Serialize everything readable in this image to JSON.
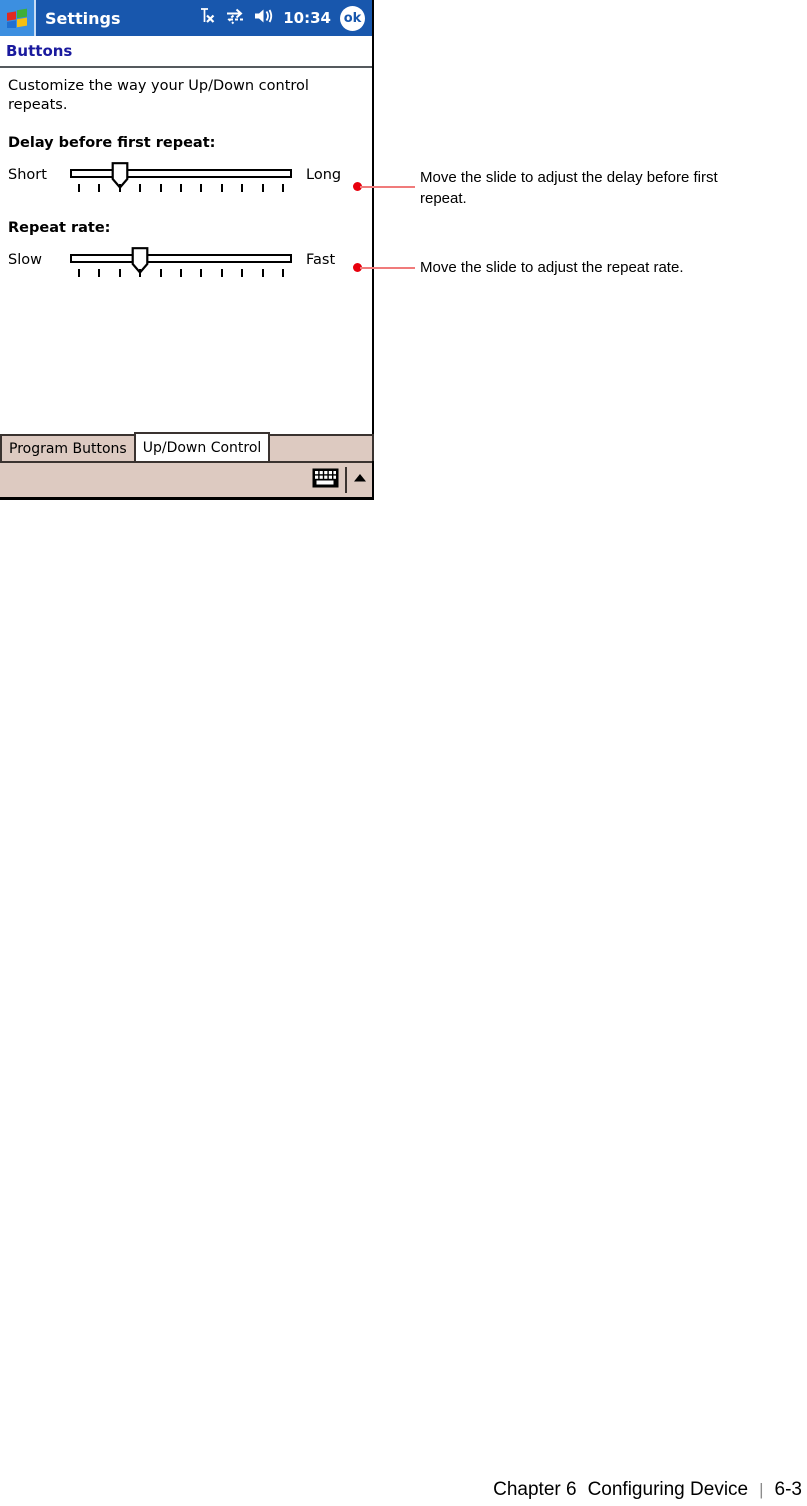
{
  "device": {
    "titlebar": {
      "start_icon": "windows-logo-icon",
      "title": "Settings",
      "icons": [
        {
          "name": "signal-no-service-icon",
          "glyph": "Tx"
        },
        {
          "name": "connectivity-icon",
          "glyph": "arrows"
        },
        {
          "name": "volume-speaker-icon",
          "glyph": "speaker"
        }
      ],
      "time": "10:34",
      "ok_label": "ok"
    },
    "page_title": "Buttons",
    "description": "Customize the way your Up/Down control repeats.",
    "settings": [
      {
        "id": "delay-before-first-repeat",
        "label": "Delay before first repeat:",
        "min_label": "Short",
        "max_label": "Long",
        "ticks": 11,
        "value_index": 2
      },
      {
        "id": "repeat-rate",
        "label": "Repeat rate:",
        "min_label": "Slow",
        "max_label": "Fast",
        "ticks": 11,
        "value_index": 3
      }
    ],
    "tabs": [
      {
        "label": "Program Buttons",
        "active": false
      },
      {
        "label": "Up/Down Control",
        "active": true
      },
      {
        "label": "",
        "active": false
      }
    ],
    "taskbar": {
      "keyboard_icon": "keyboard-icon",
      "input_selector_icon": "chevron-up-icon"
    }
  },
  "annotations": [
    {
      "id": "callout-delay",
      "text": "Move the slide to adjust the delay before first repeat."
    },
    {
      "id": "callout-repeat-rate",
      "text": "Move the slide to adjust the repeat rate."
    }
  ],
  "footer": {
    "chapter": "Chapter 6",
    "section": "Configuring Device",
    "separator": "|",
    "page": "6-3"
  },
  "colors": {
    "titlebar_blue": "#1857ad",
    "start_blue": "#3c8fe0",
    "header_navy": "#1a1a9e",
    "taskbar_tan": "#ddcac1",
    "callout_red": "#e8000d",
    "callout_line": "#f07b7b"
  }
}
